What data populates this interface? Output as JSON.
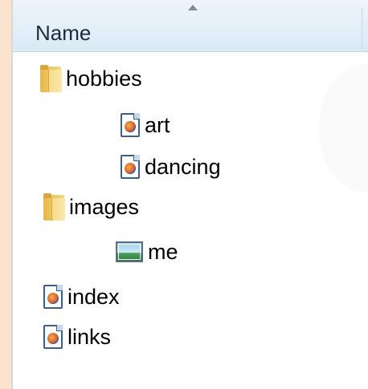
{
  "header": {
    "column_label": "Name",
    "sort_direction": "ascending"
  },
  "tree": [
    {
      "name": "hobbies",
      "type": "folder",
      "icon": "folder-icon",
      "level": 0
    },
    {
      "name": "art",
      "type": "html",
      "icon": "html-document-icon",
      "level": 2
    },
    {
      "name": "dancing",
      "type": "html",
      "icon": "html-document-icon",
      "level": 2
    },
    {
      "name": "images",
      "type": "folder",
      "icon": "folder-icon",
      "level": 0
    },
    {
      "name": "me",
      "type": "image",
      "icon": "image-file-icon",
      "level": 2
    },
    {
      "name": "index",
      "type": "html",
      "icon": "html-document-icon",
      "level": 0
    },
    {
      "name": "links",
      "type": "html",
      "icon": "html-document-icon",
      "level": 0
    }
  ]
}
